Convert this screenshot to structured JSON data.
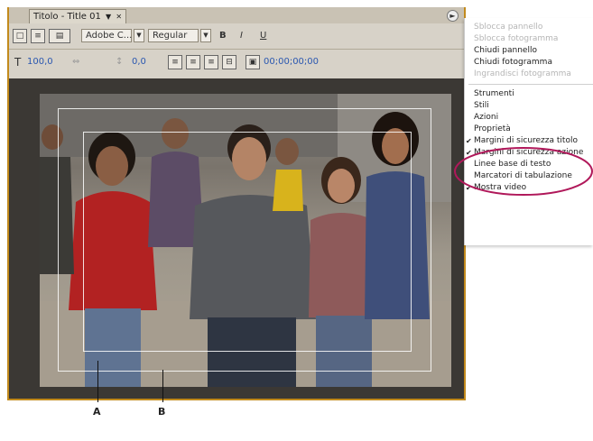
{
  "panel": {
    "tab_label": "Titolo - Title 01",
    "toolbar1": {
      "font_family": "Adobe C...",
      "font_style": "Regular",
      "bold": "B",
      "italic": "I",
      "underline": "U"
    },
    "toolbar2": {
      "font_size": "100,0",
      "leading": "0,0",
      "timecode": "00;00;00;00"
    }
  },
  "menu": {
    "items": [
      {
        "label": "Sblocca pannello",
        "disabled": true
      },
      {
        "label": "Sblocca fotogramma",
        "disabled": true
      },
      {
        "label": "Chiudi pannello"
      },
      {
        "label": "Chiudi fotogramma"
      },
      {
        "label": "Ingrandisci fotogramma",
        "disabled": true
      },
      {
        "label": "Strumenti"
      },
      {
        "label": "Stili"
      },
      {
        "label": "Azioni"
      },
      {
        "label": "Proprietà"
      },
      {
        "label": "Margini di sicurezza titolo",
        "checked": true
      },
      {
        "label": "Margini di sicurezza azione",
        "checked": true
      },
      {
        "label": "Linee base di testo"
      },
      {
        "label": "Marcatori di tabulazione"
      },
      {
        "label": "Mostra video",
        "checked": true
      }
    ]
  },
  "callouts": {
    "a": "A",
    "b": "B"
  },
  "colors": {
    "highlight_ellipse": "#b0185a",
    "panel_border": "#c28a1c"
  }
}
